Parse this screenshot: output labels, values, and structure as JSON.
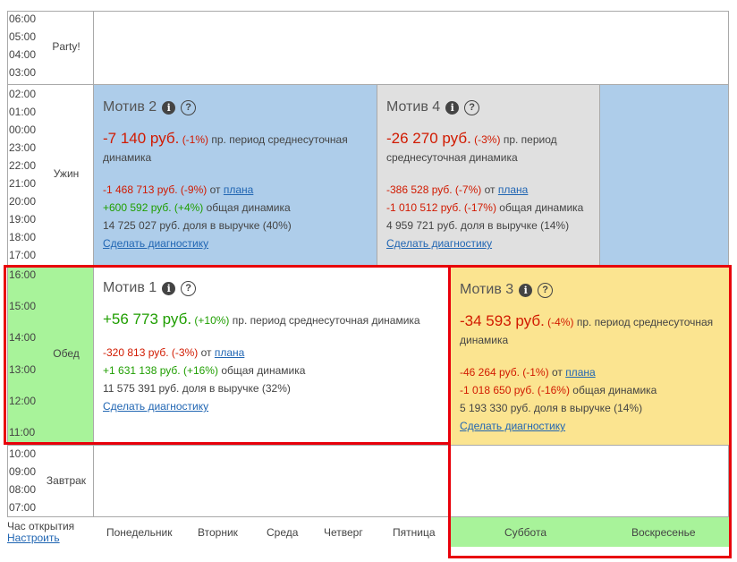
{
  "hours": {
    "party": [
      "06:00",
      "05:00",
      "04:00",
      "03:00"
    ],
    "dinner": [
      "02:00",
      "01:00",
      "00:00",
      "23:00",
      "22:00",
      "21:00",
      "20:00",
      "19:00",
      "18:00",
      "17:00"
    ],
    "lunch": [
      "16:00",
      "15:00",
      "14:00",
      "13:00",
      "12:00",
      "11:00"
    ],
    "breakfast": [
      "10:00",
      "09:00",
      "08:00",
      "07:00"
    ]
  },
  "rows": {
    "party": "Party!",
    "dinner": "Ужин",
    "lunch": "Обед",
    "breakfast": "Завтрак"
  },
  "footer": {
    "open_hour": "Час открытия",
    "configure": "Настроить",
    "days": [
      "Понедельник",
      "Вторник",
      "Среда",
      "Четверг",
      "Пятница",
      "Суббота",
      "Воскресенье"
    ]
  },
  "motives": {
    "m2": {
      "title": "Мотив 2",
      "amount": "-7 140 руб.",
      "pct": "(-1%)",
      "desc": "пр. период среднесуточная динамика",
      "plan_amount": "-1 468 713 руб. (-9%)",
      "plan_from": "от",
      "plan_link": "плана",
      "total_amount": "+600 592 руб. (+4%)",
      "total_label": "общая динамика",
      "share": "14 725 027 руб. доля в выручке (40%)",
      "diag": "Сделать диагностику"
    },
    "m4": {
      "title": "Мотив 4",
      "amount": "-26 270 руб.",
      "pct": "(-3%)",
      "desc": "пр. период среднесуточная динамика",
      "plan_amount": "-386 528 руб. (-7%)",
      "plan_from": "от",
      "plan_link": "плана",
      "total_amount": "-1 010 512 руб. (-17%)",
      "total_label": "общая динамика",
      "share": "4 959 721 руб. доля в выручке (14%)",
      "diag": "Сделать диагностику"
    },
    "m1": {
      "title": "Мотив 1",
      "amount": "+56 773 руб.",
      "pct": "(+10%)",
      "desc": "пр. период среднесуточная динамика",
      "plan_amount": "-320 813 руб. (-3%)",
      "plan_from": "от",
      "plan_link": "плана",
      "total_amount": "+1 631 138 руб. (+16%)",
      "total_label": "общая динамика",
      "share": "11 575 391 руб. доля в выручке (32%)",
      "diag": "Сделать диагностику"
    },
    "m3": {
      "title": "Мотив 3",
      "amount": "-34 593 руб.",
      "pct": "(-4%)",
      "desc": "пр. период среднесуточная динамика",
      "plan_amount": "-46 264 руб. (-1%)",
      "plan_from": "от",
      "plan_link": "плана",
      "total_amount": "-1 018 650 руб. (-16%)",
      "total_label": "общая динамика",
      "share": "5 193 330 руб. доля в выручке (14%)",
      "diag": "Сделать диагностику"
    }
  },
  "icons": {
    "info": "info-icon",
    "help": "question-icon"
  },
  "colors": {
    "blue": "#aecdea",
    "gray": "#e0e0e0",
    "yellow": "#fbe490",
    "green": "#a8f39a",
    "highlight": "#e8000a",
    "negative": "#d11a00",
    "positive": "#1f9e00"
  }
}
